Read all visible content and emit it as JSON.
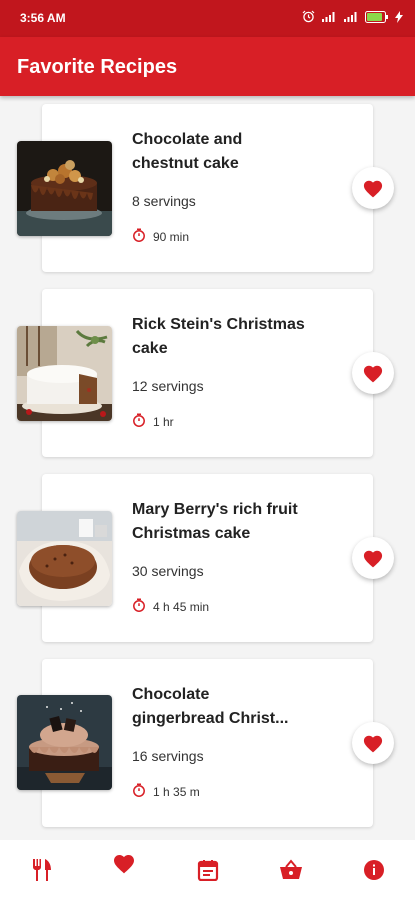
{
  "status_bar": {
    "time": "3:56 AM"
  },
  "app_bar": {
    "title": "Favorite Recipes"
  },
  "recipes": [
    {
      "title_line1": "Chocolate and",
      "title_line2": "chestnut cake",
      "servings": "8 servings",
      "time": "90 min",
      "favorite": true,
      "image": "chocolate-chestnut-cake"
    },
    {
      "title_line1": "Rick Stein's Christmas",
      "title_line2": "cake",
      "servings": "12 servings",
      "time": "1 hr",
      "favorite": true,
      "image": "white-christmas-cake"
    },
    {
      "title_line1": "Mary Berry's rich fruit",
      "title_line2": "Christmas cake",
      "servings": "30 servings",
      "time": "4 h 45 min",
      "favorite": true,
      "image": "rich-fruit-cake"
    },
    {
      "title_line1": "Chocolate",
      "title_line2": "gingerbread Christ...",
      "servings": "16 servings",
      "time": "1 h 35 m",
      "favorite": true,
      "image": "chocolate-gingerbread-cake"
    }
  ],
  "bottom_nav": [
    {
      "icon": "fork-knife-icon",
      "active": false
    },
    {
      "icon": "heart-icon",
      "active": true
    },
    {
      "icon": "calendar-icon",
      "active": false
    },
    {
      "icon": "basket-icon",
      "active": false
    },
    {
      "icon": "info-icon",
      "active": false
    }
  ],
  "colors": {
    "primary": "#d81f26",
    "primary_dark": "#c1161d",
    "background": "#f4f4f4"
  }
}
